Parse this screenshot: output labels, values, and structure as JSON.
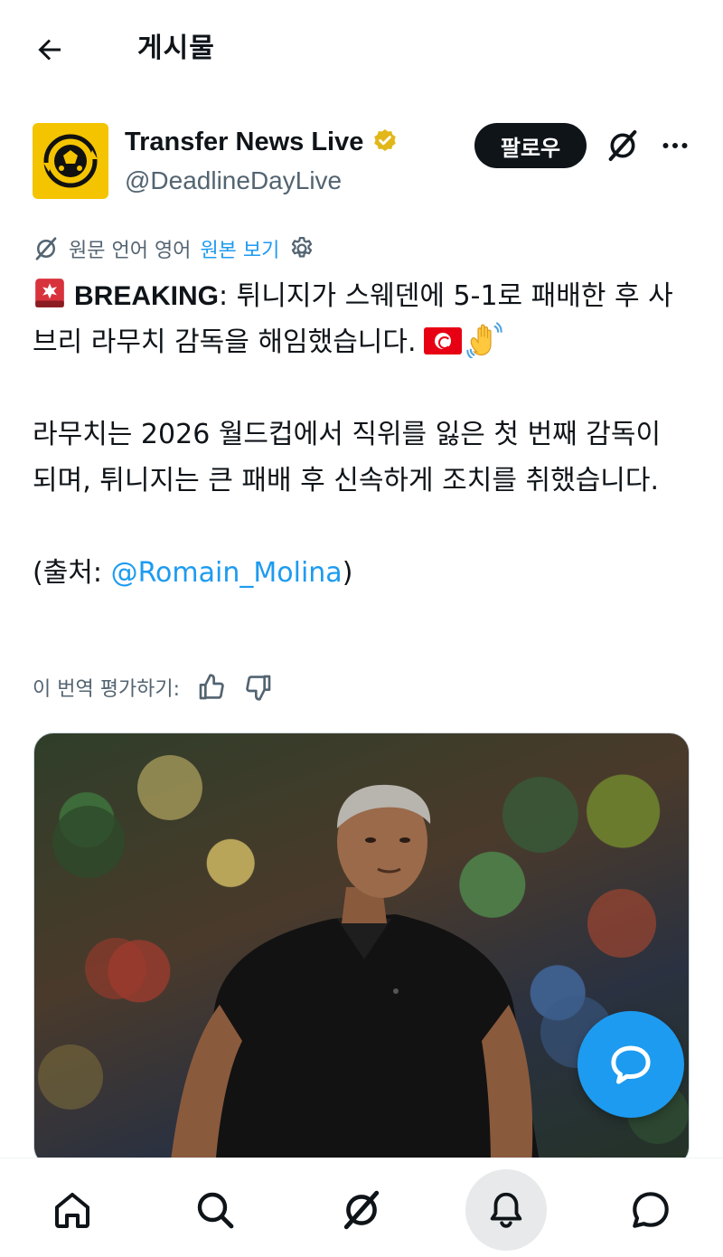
{
  "header": {
    "title": "게시물"
  },
  "author": {
    "name": "Transfer News Live",
    "handle": "@DeadlineDayLive",
    "follow_label": "팔로우"
  },
  "translation": {
    "info_text": "원문 언어 영어",
    "show_original_label": "원본 보기"
  },
  "tweet": {
    "breaking_label": "BREAKING",
    "line1_rest": ": 튀니지가 스웨덴에 5-1로 패배한 후 사브리 라무치 감독을 해임했습니다.",
    "paragraph2": "라무치는 2026 월드컵에서 직위를 잃은 첫 번째 감독이 되며, 튀니지는 큰 패배 후 신속하게 조치를 취했습니다.",
    "source_prefix": "(출처: ",
    "source_mention": "@Romain_Molina",
    "source_suffix": ")"
  },
  "rate_translation": {
    "label": "이 번역 평가하기:"
  },
  "colors": {
    "accent": "#1d9bf0",
    "text": "#0f1419",
    "secondary": "#536471",
    "avatar_bg": "#f4c400",
    "verified": "#e2b719"
  },
  "icons": {
    "back": "arrow-left-icon",
    "verified": "verified-badge-icon",
    "grok": "grok-icon",
    "more": "more-dots-icon",
    "translate": "grok-icon",
    "settings": "gear-icon",
    "thumbs_up": "thumbs-up-icon",
    "thumbs_down": "thumbs-down-icon",
    "compose": "chat-bubble-icon",
    "nav": [
      "home-icon",
      "search-icon",
      "grok-icon",
      "bell-icon",
      "message-icon"
    ]
  },
  "nav": {
    "active_index": 3
  }
}
